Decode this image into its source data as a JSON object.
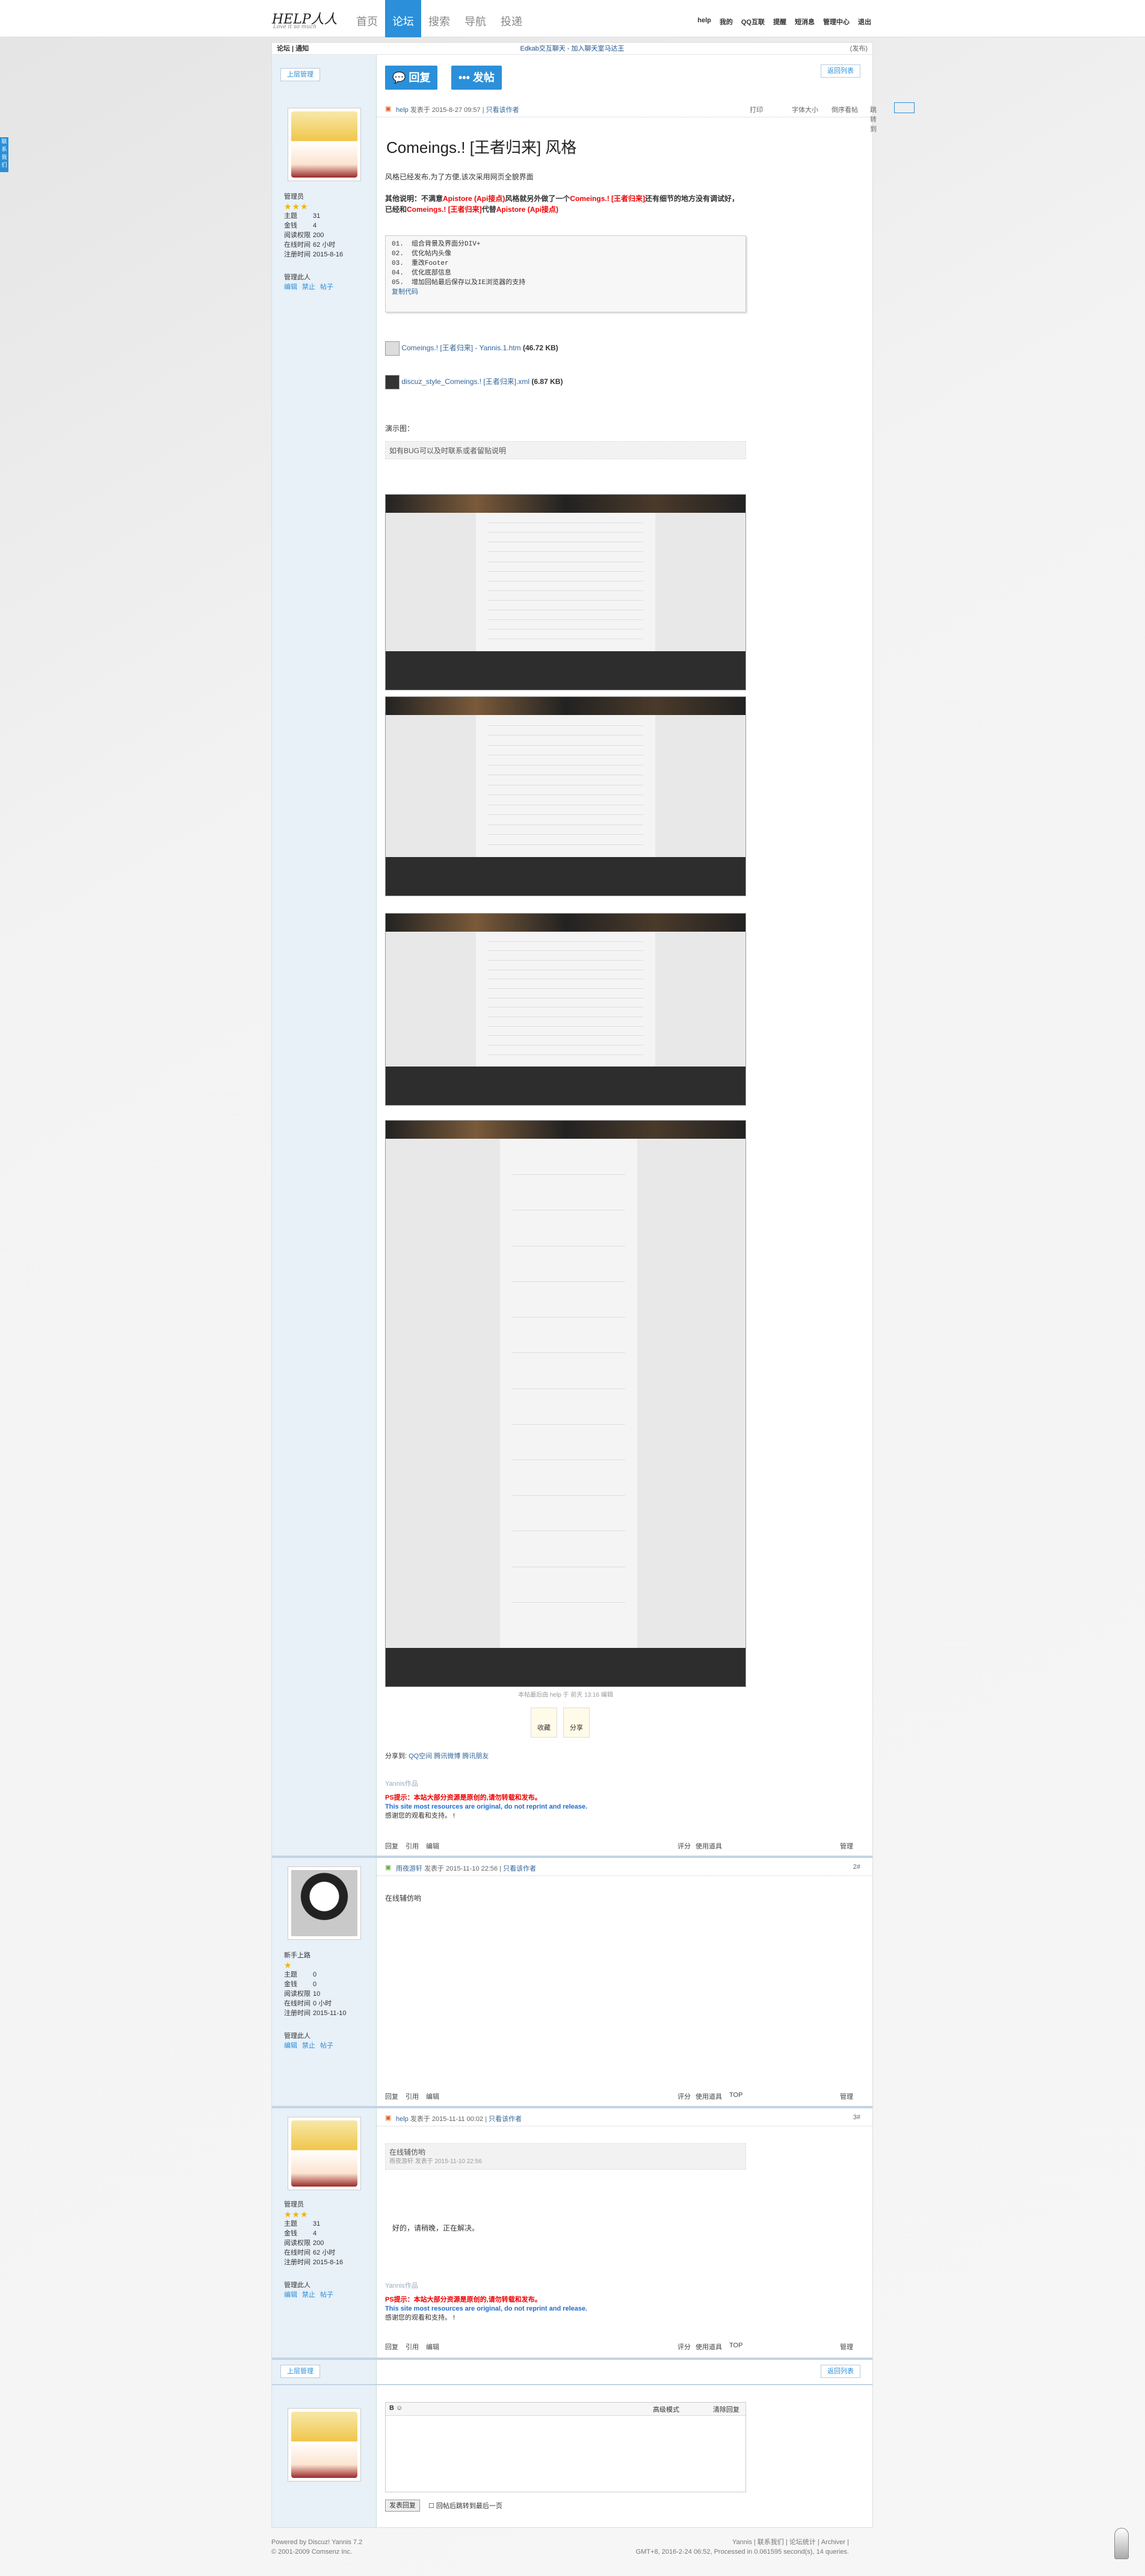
{
  "logo": {
    "text": "HELP人人",
    "tagline": "Love it so much"
  },
  "nav": [
    "首页",
    "论坛",
    "搜索",
    "导航",
    "投递"
  ],
  "nav_active": 1,
  "topright": [
    "help",
    "我的",
    "QQ互联",
    "提醒",
    "短消息",
    "管理中心",
    "退出"
  ],
  "sidetab": "联系我们",
  "notice": {
    "title": "论坛 | 通知",
    "center": "Edkab交互聊天 - 加入聊天室马达王",
    "right": "(发布)"
  },
  "thread": {
    "back_label": "上层管理",
    "return_list": "返回列表",
    "reply_btn": "回复",
    "post_btn": "发帖",
    "title": "Comeings.! [王者归来] 风格",
    "author": "help",
    "posted": "发表于 2015-8-27 09:57",
    "only_author": "只看该作者",
    "print": "打印",
    "font": "字体大小",
    "reverse": "倒序看帖",
    "jump": "跳转到",
    "p1": "风格已经发布,为了方便,该次采用网页全貌界面",
    "p2a": "其他说明：不满意",
    "p2b": "Apistore (Api接点)",
    "p2c": "风格就另外做了一个",
    "p2d": "Comeings.! [王者归来]",
    "p2e": "还有细节的地方没有调试好，已经和",
    "p2f": "Comeings.! [王者归来]",
    "p2g": "代替",
    "p2h": "Apistore (Api接点)",
    "code": [
      "组合背景及界面分DIV+",
      "优化帖内头像",
      "重改Footer",
      "优化底部信息",
      "增加回帖最后保存以及IE浏览器的支持"
    ],
    "copy_code": "复制代码",
    "att1": "Comeings.! [王者归来] - Yannis.1.htm",
    "att1_size": "(46.72 KB)",
    "att2": "discuz_style_Comeings.! [王者归来].xml",
    "att2_size": "(6.87 KB)",
    "demo_label": "演示图：",
    "demo_quote": "如有BUG可以及时联系或者留贴说明",
    "edit_note": "本帖最后由 help 于 前天 13:16 编辑",
    "fav": "收藏",
    "share": "分享",
    "share_to": "分享到:",
    "share_targets": [
      "QQ空间",
      "腾讯微博",
      "腾讯朋友"
    ],
    "sig_label": "Yannis作品",
    "sig_red": "PS提示：本站大部分资源是原创的,请勿转载和发布。",
    "sig_blue": "This site most resources are original, do not reprint and release.",
    "sig_black": "感谢您的观看和支持。 !",
    "actions": [
      "回复",
      "引用",
      "编辑"
    ],
    "rate": "评分",
    "tools": "使用道具",
    "top": "TOP",
    "manage": "管理"
  },
  "users": [
    {
      "role": "管理员",
      "stats": [
        [
          "主题",
          "31"
        ],
        [
          "金钱",
          "4"
        ],
        [
          "阅读权限",
          "200"
        ],
        [
          "在线时间",
          "62 小时"
        ],
        [
          "注册时间",
          "2015-8-16"
        ]
      ],
      "mgr": "管理此人",
      "links": [
        "编辑",
        "禁止",
        "帖子"
      ]
    },
    {
      "role": "新手上路",
      "stats": [
        [
          "主题",
          "0"
        ],
        [
          "金钱",
          "0"
        ],
        [
          "阅读权限",
          "10"
        ],
        [
          "在线时间",
          "0 小时"
        ],
        [
          "注册时间",
          "2015-11-10"
        ]
      ],
      "mgr": "管理此人",
      "links": [
        "编辑",
        "禁止",
        "帖子"
      ]
    },
    {
      "role": "管理员",
      "stats": [
        [
          "主题",
          "31"
        ],
        [
          "金钱",
          "4"
        ],
        [
          "阅读权限",
          "200"
        ],
        [
          "在线时间",
          "62 小时"
        ],
        [
          "注册时间",
          "2015-8-16"
        ]
      ],
      "mgr": "管理此人",
      "links": [
        "编辑",
        "禁止",
        "帖子"
      ]
    }
  ],
  "reply1": {
    "author": "雨夜游轩",
    "posted": "发表于 2015-11-10 22:56",
    "only_author": "只看该作者",
    "text": "在线辅仿哟",
    "floor": "2#"
  },
  "reply2": {
    "author": "help",
    "posted": "发表于 2015-11-11 00:02",
    "only_author": "只看该作者",
    "quote": "在线辅仿哟",
    "quote_by": "雨夜游轩 发表于 2015-11-10 22:56",
    "text": "好的，请稍晚，正在解决。",
    "floor": "3#"
  },
  "editor": {
    "adv": "高级模式",
    "clear": "清除回复",
    "submit": "发表回复",
    "check": "回帖后跳转到最后一页"
  },
  "footer": {
    "powered": "Powered by Discuz! Yannis 7.2",
    "copy": "© 2001-2009 Comsenz Inc.",
    "right": "Yannis | 联系我们 | 论坛统计 | Archiver |",
    "gmt": "GMT+8, 2016-2-24 06:52, Processed in 0.061595 second(s), 14 queries."
  }
}
